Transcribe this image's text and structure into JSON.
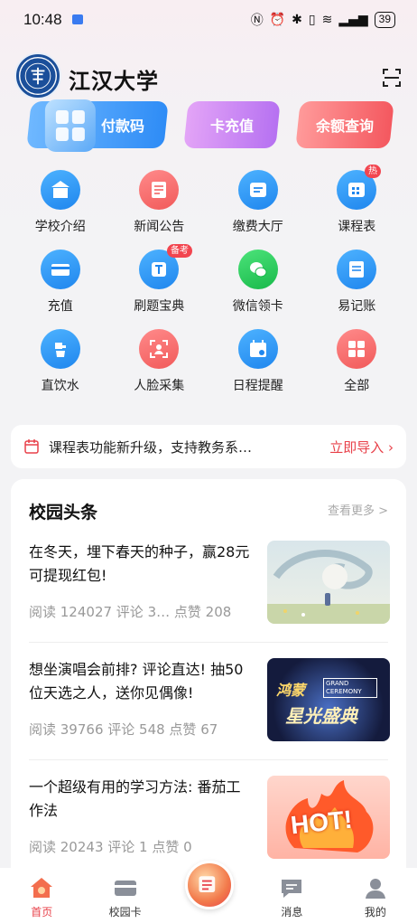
{
  "status": {
    "time": "10:48",
    "battery": "39",
    "network": "5G"
  },
  "header": {
    "title": "江汉大学"
  },
  "top_buttons": {
    "pay": "付款码",
    "recharge": "卡充值",
    "balance": "余额查询"
  },
  "grid": [
    {
      "label": "学校介绍",
      "icon": "school-icon",
      "color": "blue"
    },
    {
      "label": "新闻公告",
      "icon": "news-icon",
      "color": "red"
    },
    {
      "label": "缴费大厅",
      "icon": "payment-icon",
      "color": "blue"
    },
    {
      "label": "课程表",
      "icon": "schedule-icon",
      "color": "blue",
      "badge": "热"
    },
    {
      "label": "充值",
      "icon": "card-icon",
      "color": "blue"
    },
    {
      "label": "刷题宝典",
      "icon": "quiz-icon",
      "color": "blue",
      "badge": "备考"
    },
    {
      "label": "微信领卡",
      "icon": "wechat-icon",
      "color": "green"
    },
    {
      "label": "易记账",
      "icon": "ledger-icon",
      "color": "blue"
    },
    {
      "label": "直饮水",
      "icon": "water-icon",
      "color": "blue"
    },
    {
      "label": "人脸采集",
      "icon": "face-scan-icon",
      "color": "red"
    },
    {
      "label": "日程提醒",
      "icon": "calendar-icon",
      "color": "blue"
    },
    {
      "label": "全部",
      "icon": "all-apps-icon",
      "color": "red"
    }
  ],
  "notice": {
    "text": "课程表功能新升级，支持教务系…",
    "link": "立即导入 ›"
  },
  "news_section": {
    "title": "校园头条",
    "more": "查看更多 >",
    "items": [
      {
        "title": "在冬天，埋下春天的种子，赢28元可提现红包!",
        "meta": "阅读 124027 评论 3… 点赞 208"
      },
      {
        "title": "想坐演唱会前排? 评论直达! 抽50位天选之人，送你见偶像!",
        "meta": "阅读 39766   评论 548   点赞 67",
        "thumb_text_1": "鸿蒙",
        "thumb_text_2": "星光盛典",
        "thumb_text_3": "GRAND CEREMONY"
      },
      {
        "title": "一个超级有用的学习方法: 番茄工作法",
        "meta": "阅读 20243   评论 1       点赞 0",
        "thumb_text": "HOT!"
      }
    ]
  },
  "tabbar": [
    {
      "label": "首页",
      "icon": "home-icon",
      "active": true
    },
    {
      "label": "校园卡",
      "icon": "campus-card-icon",
      "active": false
    },
    {
      "label": "",
      "icon": "promo-icon",
      "active": false
    },
    {
      "label": "消息",
      "icon": "message-icon",
      "active": false
    },
    {
      "label": "我的",
      "icon": "profile-icon",
      "active": false
    }
  ]
}
